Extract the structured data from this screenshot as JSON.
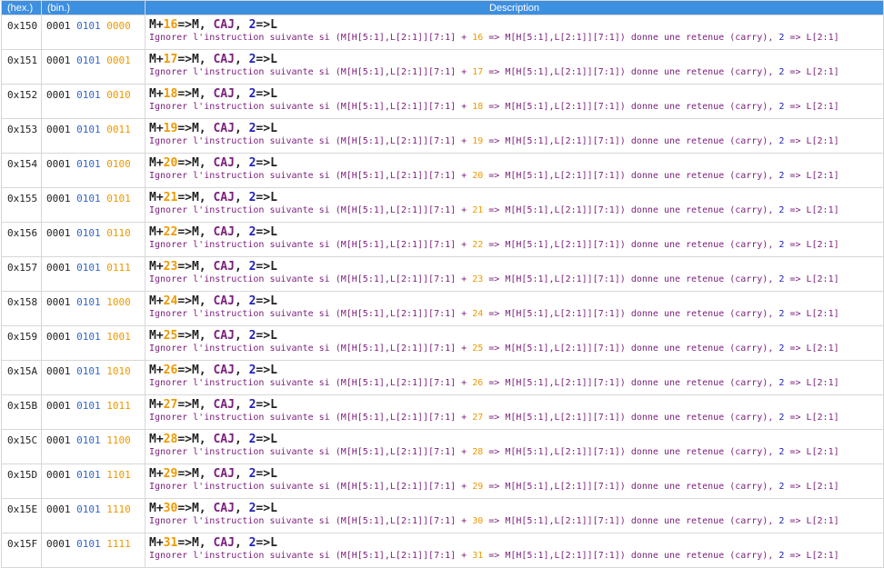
{
  "headers": {
    "hex": "(hex.)",
    "bin": "(bin.)",
    "desc": "Description"
  },
  "rows": [
    {
      "hex": "0x150",
      "b1": "0001",
      "b2": "0101",
      "b3": "0000",
      "title_pre": "M+",
      "n": "16",
      "title_mid": "=>M, ",
      "k": "CAJ",
      "title_sep": ", ",
      "l": "2",
      "title_post": "=>L",
      "text_pre": "Ignorer l'instruction suivante si (M[H[5:1],L[2:1]][7:1] + ",
      "text_n": "16",
      "text_mid": " => M[H[5:1],L[2:1]][7:1]) donne une retenue (carry), ",
      "text_l": "2",
      "text_post": " => L[2:1]"
    },
    {
      "hex": "0x151",
      "b1": "0001",
      "b2": "0101",
      "b3": "0001",
      "title_pre": "M+",
      "n": "17",
      "title_mid": "=>M, ",
      "k": "CAJ",
      "title_sep": ", ",
      "l": "2",
      "title_post": "=>L",
      "text_pre": "Ignorer l'instruction suivante si (M[H[5:1],L[2:1]][7:1] + ",
      "text_n": "17",
      "text_mid": " => M[H[5:1],L[2:1]][7:1]) donne une retenue (carry), ",
      "text_l": "2",
      "text_post": " => L[2:1]"
    },
    {
      "hex": "0x152",
      "b1": "0001",
      "b2": "0101",
      "b3": "0010",
      "title_pre": "M+",
      "n": "18",
      "title_mid": "=>M, ",
      "k": "CAJ",
      "title_sep": ", ",
      "l": "2",
      "title_post": "=>L",
      "text_pre": "Ignorer l'instruction suivante si (M[H[5:1],L[2:1]][7:1] + ",
      "text_n": "18",
      "text_mid": " => M[H[5:1],L[2:1]][7:1]) donne une retenue (carry), ",
      "text_l": "2",
      "text_post": " => L[2:1]"
    },
    {
      "hex": "0x153",
      "b1": "0001",
      "b2": "0101",
      "b3": "0011",
      "title_pre": "M+",
      "n": "19",
      "title_mid": "=>M, ",
      "k": "CAJ",
      "title_sep": ", ",
      "l": "2",
      "title_post": "=>L",
      "text_pre": "Ignorer l'instruction suivante si (M[H[5:1],L[2:1]][7:1] + ",
      "text_n": "19",
      "text_mid": " => M[H[5:1],L[2:1]][7:1]) donne une retenue (carry), ",
      "text_l": "2",
      "text_post": " => L[2:1]"
    },
    {
      "hex": "0x154",
      "b1": "0001",
      "b2": "0101",
      "b3": "0100",
      "title_pre": "M+",
      "n": "20",
      "title_mid": "=>M, ",
      "k": "CAJ",
      "title_sep": ", ",
      "l": "2",
      "title_post": "=>L",
      "text_pre": "Ignorer l'instruction suivante si (M[H[5:1],L[2:1]][7:1] + ",
      "text_n": "20",
      "text_mid": " => M[H[5:1],L[2:1]][7:1]) donne une retenue (carry), ",
      "text_l": "2",
      "text_post": " => L[2:1]"
    },
    {
      "hex": "0x155",
      "b1": "0001",
      "b2": "0101",
      "b3": "0101",
      "title_pre": "M+",
      "n": "21",
      "title_mid": "=>M, ",
      "k": "CAJ",
      "title_sep": ", ",
      "l": "2",
      "title_post": "=>L",
      "text_pre": "Ignorer l'instruction suivante si (M[H[5:1],L[2:1]][7:1] + ",
      "text_n": "21",
      "text_mid": " => M[H[5:1],L[2:1]][7:1]) donne une retenue (carry), ",
      "text_l": "2",
      "text_post": " => L[2:1]"
    },
    {
      "hex": "0x156",
      "b1": "0001",
      "b2": "0101",
      "b3": "0110",
      "title_pre": "M+",
      "n": "22",
      "title_mid": "=>M, ",
      "k": "CAJ",
      "title_sep": ", ",
      "l": "2",
      "title_post": "=>L",
      "text_pre": "Ignorer l'instruction suivante si (M[H[5:1],L[2:1]][7:1] + ",
      "text_n": "22",
      "text_mid": " => M[H[5:1],L[2:1]][7:1]) donne une retenue (carry), ",
      "text_l": "2",
      "text_post": " => L[2:1]"
    },
    {
      "hex": "0x157",
      "b1": "0001",
      "b2": "0101",
      "b3": "0111",
      "title_pre": "M+",
      "n": "23",
      "title_mid": "=>M, ",
      "k": "CAJ",
      "title_sep": ", ",
      "l": "2",
      "title_post": "=>L",
      "text_pre": "Ignorer l'instruction suivante si (M[H[5:1],L[2:1]][7:1] + ",
      "text_n": "23",
      "text_mid": " => M[H[5:1],L[2:1]][7:1]) donne une retenue (carry), ",
      "text_l": "2",
      "text_post": " => L[2:1]"
    },
    {
      "hex": "0x158",
      "b1": "0001",
      "b2": "0101",
      "b3": "1000",
      "title_pre": "M+",
      "n": "24",
      "title_mid": "=>M, ",
      "k": "CAJ",
      "title_sep": ", ",
      "l": "2",
      "title_post": "=>L",
      "text_pre": "Ignorer l'instruction suivante si (M[H[5:1],L[2:1]][7:1] + ",
      "text_n": "24",
      "text_mid": " => M[H[5:1],L[2:1]][7:1]) donne une retenue (carry), ",
      "text_l": "2",
      "text_post": " => L[2:1]"
    },
    {
      "hex": "0x159",
      "b1": "0001",
      "b2": "0101",
      "b3": "1001",
      "title_pre": "M+",
      "n": "25",
      "title_mid": "=>M, ",
      "k": "CAJ",
      "title_sep": ", ",
      "l": "2",
      "title_post": "=>L",
      "text_pre": "Ignorer l'instruction suivante si (M[H[5:1],L[2:1]][7:1] + ",
      "text_n": "25",
      "text_mid": " => M[H[5:1],L[2:1]][7:1]) donne une retenue (carry), ",
      "text_l": "2",
      "text_post": " => L[2:1]"
    },
    {
      "hex": "0x15A",
      "b1": "0001",
      "b2": "0101",
      "b3": "1010",
      "title_pre": "M+",
      "n": "26",
      "title_mid": "=>M, ",
      "k": "CAJ",
      "title_sep": ", ",
      "l": "2",
      "title_post": "=>L",
      "text_pre": "Ignorer l'instruction suivante si (M[H[5:1],L[2:1]][7:1] + ",
      "text_n": "26",
      "text_mid": " => M[H[5:1],L[2:1]][7:1]) donne une retenue (carry), ",
      "text_l": "2",
      "text_post": " => L[2:1]"
    },
    {
      "hex": "0x15B",
      "b1": "0001",
      "b2": "0101",
      "b3": "1011",
      "title_pre": "M+",
      "n": "27",
      "title_mid": "=>M, ",
      "k": "CAJ",
      "title_sep": ", ",
      "l": "2",
      "title_post": "=>L",
      "text_pre": "Ignorer l'instruction suivante si (M[H[5:1],L[2:1]][7:1] + ",
      "text_n": "27",
      "text_mid": " => M[H[5:1],L[2:1]][7:1]) donne une retenue (carry), ",
      "text_l": "2",
      "text_post": " => L[2:1]"
    },
    {
      "hex": "0x15C",
      "b1": "0001",
      "b2": "0101",
      "b3": "1100",
      "title_pre": "M+",
      "n": "28",
      "title_mid": "=>M, ",
      "k": "CAJ",
      "title_sep": ", ",
      "l": "2",
      "title_post": "=>L",
      "text_pre": "Ignorer l'instruction suivante si (M[H[5:1],L[2:1]][7:1] + ",
      "text_n": "28",
      "text_mid": " => M[H[5:1],L[2:1]][7:1]) donne une retenue (carry), ",
      "text_l": "2",
      "text_post": " => L[2:1]"
    },
    {
      "hex": "0x15D",
      "b1": "0001",
      "b2": "0101",
      "b3": "1101",
      "title_pre": "M+",
      "n": "29",
      "title_mid": "=>M, ",
      "k": "CAJ",
      "title_sep": ", ",
      "l": "2",
      "title_post": "=>L",
      "text_pre": "Ignorer l'instruction suivante si (M[H[5:1],L[2:1]][7:1] + ",
      "text_n": "29",
      "text_mid": " => M[H[5:1],L[2:1]][7:1]) donne une retenue (carry), ",
      "text_l": "2",
      "text_post": " => L[2:1]"
    },
    {
      "hex": "0x15E",
      "b1": "0001",
      "b2": "0101",
      "b3": "1110",
      "title_pre": "M+",
      "n": "30",
      "title_mid": "=>M, ",
      "k": "CAJ",
      "title_sep": ", ",
      "l": "2",
      "title_post": "=>L",
      "text_pre": "Ignorer l'instruction suivante si (M[H[5:1],L[2:1]][7:1] + ",
      "text_n": "30",
      "text_mid": " => M[H[5:1],L[2:1]][7:1]) donne une retenue (carry), ",
      "text_l": "2",
      "text_post": " => L[2:1]"
    },
    {
      "hex": "0x15F",
      "b1": "0001",
      "b2": "0101",
      "b3": "1111",
      "title_pre": "M+",
      "n": "31",
      "title_mid": "=>M, ",
      "k": "CAJ",
      "title_sep": ", ",
      "l": "2",
      "title_post": "=>L",
      "text_pre": "Ignorer l'instruction suivante si (M[H[5:1],L[2:1]][7:1] + ",
      "text_n": "31",
      "text_mid": " => M[H[5:1],L[2:1]][7:1]) donne une retenue (carry), ",
      "text_l": "2",
      "text_post": " => L[2:1]"
    }
  ]
}
